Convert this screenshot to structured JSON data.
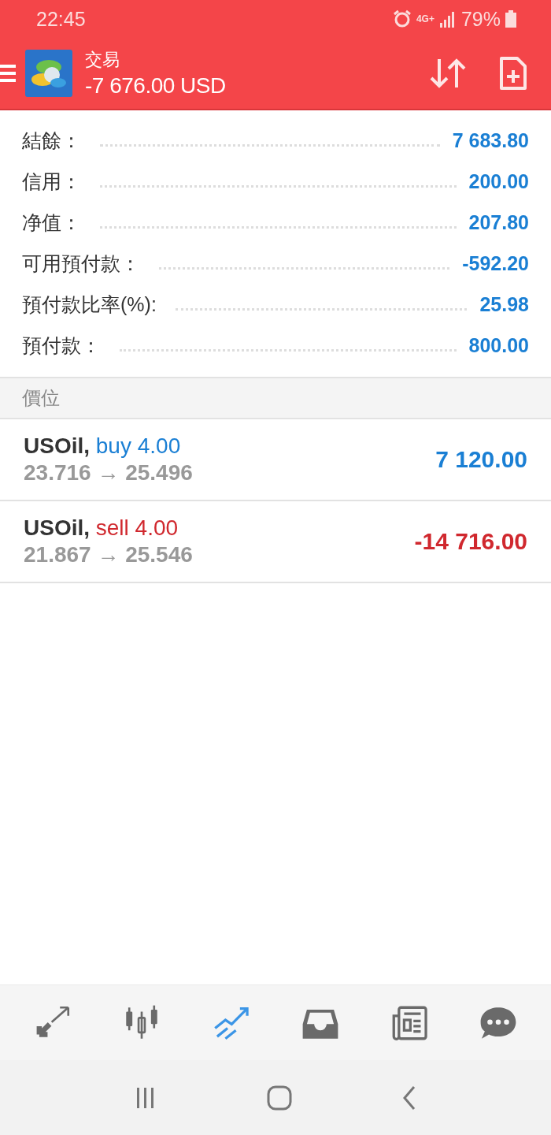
{
  "status_bar": {
    "time": "22:45",
    "network": "4G+",
    "battery": "79%"
  },
  "app_bar": {
    "title": "交易",
    "subtitle": "-7 676.00 USD"
  },
  "summary": [
    {
      "label": "結餘：",
      "value": "7 683.80"
    },
    {
      "label": "信用：",
      "value": "200.00"
    },
    {
      "label": "净值：",
      "value": "207.80"
    },
    {
      "label": "可用預付款：",
      "value": "-592.20"
    },
    {
      "label": "預付款比率(%):",
      "value": "25.98"
    },
    {
      "label": "預付款：",
      "value": "800.00"
    }
  ],
  "section": {
    "title": "價位"
  },
  "positions": [
    {
      "symbol": "USOil,",
      "side": "buy",
      "kind": "buy",
      "volume": "4.00",
      "prices": "23.716 → 25.496",
      "profit": {
        "value": "7 120.00",
        "kind": "gain"
      }
    },
    {
      "symbol": "USOil,",
      "side": "sell",
      "kind": "sell",
      "volume": "4.00",
      "prices": "21.867 → 25.546",
      "profit": {
        "value": "-14 716.00",
        "kind": "loss"
      }
    }
  ],
  "bottom_nav": [
    {
      "selected": false
    },
    {
      "selected": false
    },
    {
      "selected": true
    },
    {
      "selected": false
    },
    {
      "selected": false
    },
    {
      "selected": false
    }
  ]
}
